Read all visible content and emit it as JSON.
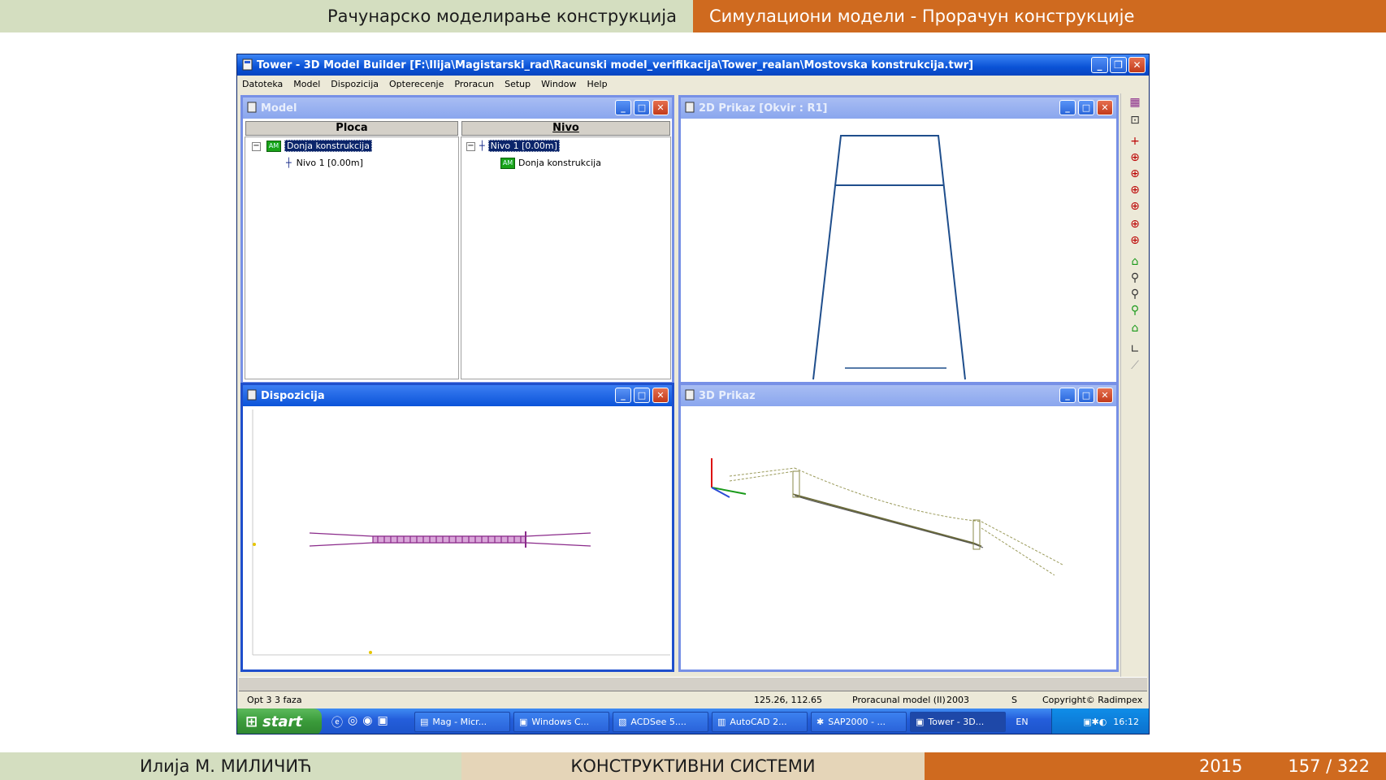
{
  "slide": {
    "header_left": "Рачунарско моделирање конструкција",
    "header_right": "Симулациони модели - Прорачун конструкције",
    "footer_author": "Илија М. МИЛИЧИЋ",
    "footer_title": "КОНСТРУКТИВНИ СИСТЕМИ",
    "footer_year": "2015",
    "footer_page": "157 / 322"
  },
  "app": {
    "title": "Tower - 3D Model Builder [F:\\Ilija\\Magistarski_rad\\Racunski model_verifikacija\\Tower_realan\\Mostovska konstrukcija.twr]",
    "menu": [
      "Datoteka",
      "Model",
      "Dispozicija",
      "Opterecenje",
      "Proracun",
      "Setup",
      "Window",
      "Help"
    ]
  },
  "model_window": {
    "title": "Model",
    "col_left": "Ploca",
    "col_right": "Nivo",
    "left_root": "Donja konstrukcija",
    "left_child": "Nivo 1 [0.00m]",
    "right_root": "Nivo 1 [0.00m]",
    "right_child": "Donja konstrukcija"
  },
  "prikaz2d": {
    "title": "2D Prikaz [Okvir : R1]"
  },
  "dispozicija": {
    "title": "Dispozicija"
  },
  "prikaz3d": {
    "title": "3D Prikaz"
  },
  "status": {
    "opt": "Opt 3 3 faza",
    "coords": "125.26, 112.65",
    "model": "Proracunal model (II)",
    "year": "2003",
    "s": "S",
    "copyright": "Copyright© Radimpex"
  },
  "taskbar": {
    "start": "start",
    "tasks": [
      "Mag - Micr...",
      "Windows C...",
      "ACDSee 5....",
      "AutoCAD 2...",
      "SAP2000 - ...",
      "Tower - 3D..."
    ],
    "lang": "EN",
    "clock": "16:12"
  },
  "colors": {
    "accent": "#cf6a1f",
    "xp_blue": "#0a52d6",
    "structure": "#1f4e8c",
    "plan": "#8a2a8a"
  }
}
